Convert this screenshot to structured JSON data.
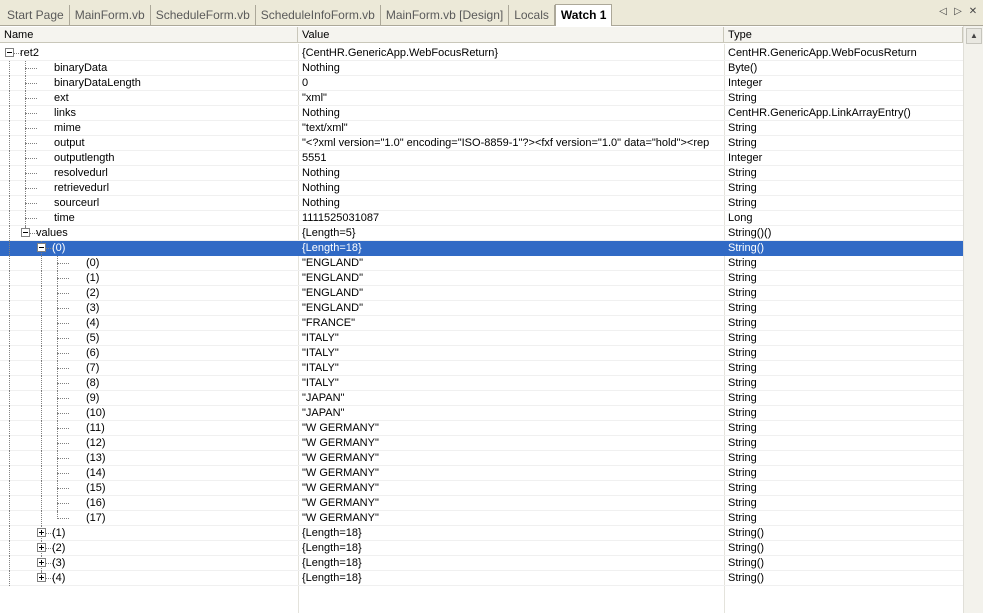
{
  "tabs": [
    {
      "label": "Start Page",
      "active": false
    },
    {
      "label": "MainForm.vb",
      "active": false
    },
    {
      "label": "ScheduleForm.vb",
      "active": false
    },
    {
      "label": "ScheduleInfoForm.vb",
      "active": false
    },
    {
      "label": "MainForm.vb [Design]",
      "active": false
    },
    {
      "label": "Locals",
      "active": false
    },
    {
      "label": "Watch 1",
      "active": true
    }
  ],
  "tab_controls": {
    "prev": "◁",
    "next": "▷",
    "close": "✕"
  },
  "columns": {
    "name": "Name",
    "value": "Value",
    "type": "Type"
  },
  "rows": [
    {
      "name": "ret2",
      "value": "{CentHR.GenericApp.WebFocusReturn}",
      "type": "CentHR.GenericApp.WebFocusReturn",
      "level": 0,
      "expander": "minus",
      "last": false
    },
    {
      "name": "binaryData",
      "value": "Nothing",
      "type": "Byte()",
      "level": 1,
      "expander": "",
      "last": false
    },
    {
      "name": "binaryDataLength",
      "value": "0",
      "type": "Integer",
      "level": 1,
      "expander": "",
      "last": false
    },
    {
      "name": "ext",
      "value": "\"xml\"",
      "type": "String",
      "level": 1,
      "expander": "",
      "last": false
    },
    {
      "name": "links",
      "value": "Nothing",
      "type": "CentHR.GenericApp.LinkArrayEntry()",
      "level": 1,
      "expander": "",
      "last": false
    },
    {
      "name": "mime",
      "value": "\"text/xml\"",
      "type": "String",
      "level": 1,
      "expander": "",
      "last": false
    },
    {
      "name": "output",
      "value": "\"<?xml version=\"1.0\" encoding=\"ISO-8859-1\"?><fxf version=\"1.0\" data=\"hold\"><rep",
      "type": "String",
      "level": 1,
      "expander": "",
      "last": false
    },
    {
      "name": "outputlength",
      "value": "5551",
      "type": "Integer",
      "level": 1,
      "expander": "",
      "last": false
    },
    {
      "name": "resolvedurl",
      "value": "Nothing",
      "type": "String",
      "level": 1,
      "expander": "",
      "last": false
    },
    {
      "name": "retrievedurl",
      "value": "Nothing",
      "type": "String",
      "level": 1,
      "expander": "",
      "last": false
    },
    {
      "name": "sourceurl",
      "value": "Nothing",
      "type": "String",
      "level": 1,
      "expander": "",
      "last": false
    },
    {
      "name": "time",
      "value": "1111525031087",
      "type": "Long",
      "level": 1,
      "expander": "",
      "last": false
    },
    {
      "name": "values",
      "value": "{Length=5}",
      "type": "String()()",
      "level": 1,
      "expander": "minus",
      "last": true
    },
    {
      "name": "(0)",
      "value": "{Length=18}",
      "type": "String()",
      "level": 2,
      "expander": "minus",
      "last": false,
      "selected": true
    },
    {
      "name": "(0)",
      "value": "\"ENGLAND\"",
      "type": "String",
      "level": 3,
      "expander": "",
      "last": false
    },
    {
      "name": "(1)",
      "value": "\"ENGLAND\"",
      "type": "String",
      "level": 3,
      "expander": "",
      "last": false
    },
    {
      "name": "(2)",
      "value": "\"ENGLAND\"",
      "type": "String",
      "level": 3,
      "expander": "",
      "last": false
    },
    {
      "name": "(3)",
      "value": "\"ENGLAND\"",
      "type": "String",
      "level": 3,
      "expander": "",
      "last": false
    },
    {
      "name": "(4)",
      "value": "\"FRANCE\"",
      "type": "String",
      "level": 3,
      "expander": "",
      "last": false
    },
    {
      "name": "(5)",
      "value": "\"ITALY\"",
      "type": "String",
      "level": 3,
      "expander": "",
      "last": false
    },
    {
      "name": "(6)",
      "value": "\"ITALY\"",
      "type": "String",
      "level": 3,
      "expander": "",
      "last": false
    },
    {
      "name": "(7)",
      "value": "\"ITALY\"",
      "type": "String",
      "level": 3,
      "expander": "",
      "last": false
    },
    {
      "name": "(8)",
      "value": "\"ITALY\"",
      "type": "String",
      "level": 3,
      "expander": "",
      "last": false
    },
    {
      "name": "(9)",
      "value": "\"JAPAN\"",
      "type": "String",
      "level": 3,
      "expander": "",
      "last": false
    },
    {
      "name": "(10)",
      "value": "\"JAPAN\"",
      "type": "String",
      "level": 3,
      "expander": "",
      "last": false
    },
    {
      "name": "(11)",
      "value": "\"W GERMANY\"",
      "type": "String",
      "level": 3,
      "expander": "",
      "last": false
    },
    {
      "name": "(12)",
      "value": "\"W GERMANY\"",
      "type": "String",
      "level": 3,
      "expander": "",
      "last": false
    },
    {
      "name": "(13)",
      "value": "\"W GERMANY\"",
      "type": "String",
      "level": 3,
      "expander": "",
      "last": false
    },
    {
      "name": "(14)",
      "value": "\"W GERMANY\"",
      "type": "String",
      "level": 3,
      "expander": "",
      "last": false
    },
    {
      "name": "(15)",
      "value": "\"W GERMANY\"",
      "type": "String",
      "level": 3,
      "expander": "",
      "last": false
    },
    {
      "name": "(16)",
      "value": "\"W GERMANY\"",
      "type": "String",
      "level": 3,
      "expander": "",
      "last": false
    },
    {
      "name": "(17)",
      "value": "\"W GERMANY\"",
      "type": "String",
      "level": 3,
      "expander": "",
      "last": true
    },
    {
      "name": "(1)",
      "value": "{Length=18}",
      "type": "String()",
      "level": 2,
      "expander": "plus",
      "last": false
    },
    {
      "name": "(2)",
      "value": "{Length=18}",
      "type": "String()",
      "level": 2,
      "expander": "plus",
      "last": false
    },
    {
      "name": "(3)",
      "value": "{Length=18}",
      "type": "String()",
      "level": 2,
      "expander": "plus",
      "last": false
    },
    {
      "name": "(4)",
      "value": "{Length=18}",
      "type": "String()",
      "level": 2,
      "expander": "plus",
      "last": true
    }
  ],
  "colors": {
    "selection": "#316ac5",
    "tabbar": "#ece9d8"
  }
}
